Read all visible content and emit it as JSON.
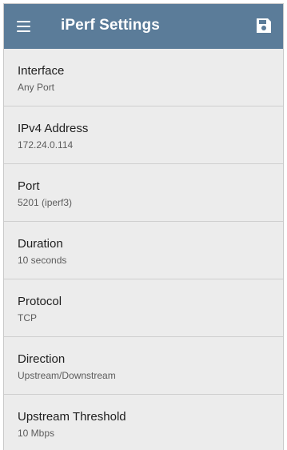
{
  "appbar": {
    "title": "iPerf Settings",
    "menu_icon": "hamburger-menu-icon",
    "save_icon": "floppy-disk-save-icon",
    "color": "#5b7c99"
  },
  "settings": [
    {
      "label": "Interface",
      "value": "Any Port"
    },
    {
      "label": "IPv4 Address",
      "value": "172.24.0.114"
    },
    {
      "label": "Port",
      "value": "5201 (iperf3)"
    },
    {
      "label": "Duration",
      "value": "10  seconds"
    },
    {
      "label": "Protocol",
      "value": "TCP"
    },
    {
      "label": "Direction",
      "value": "Upstream/Downstream"
    },
    {
      "label": "Upstream Threshold",
      "value": "10  Mbps"
    }
  ]
}
